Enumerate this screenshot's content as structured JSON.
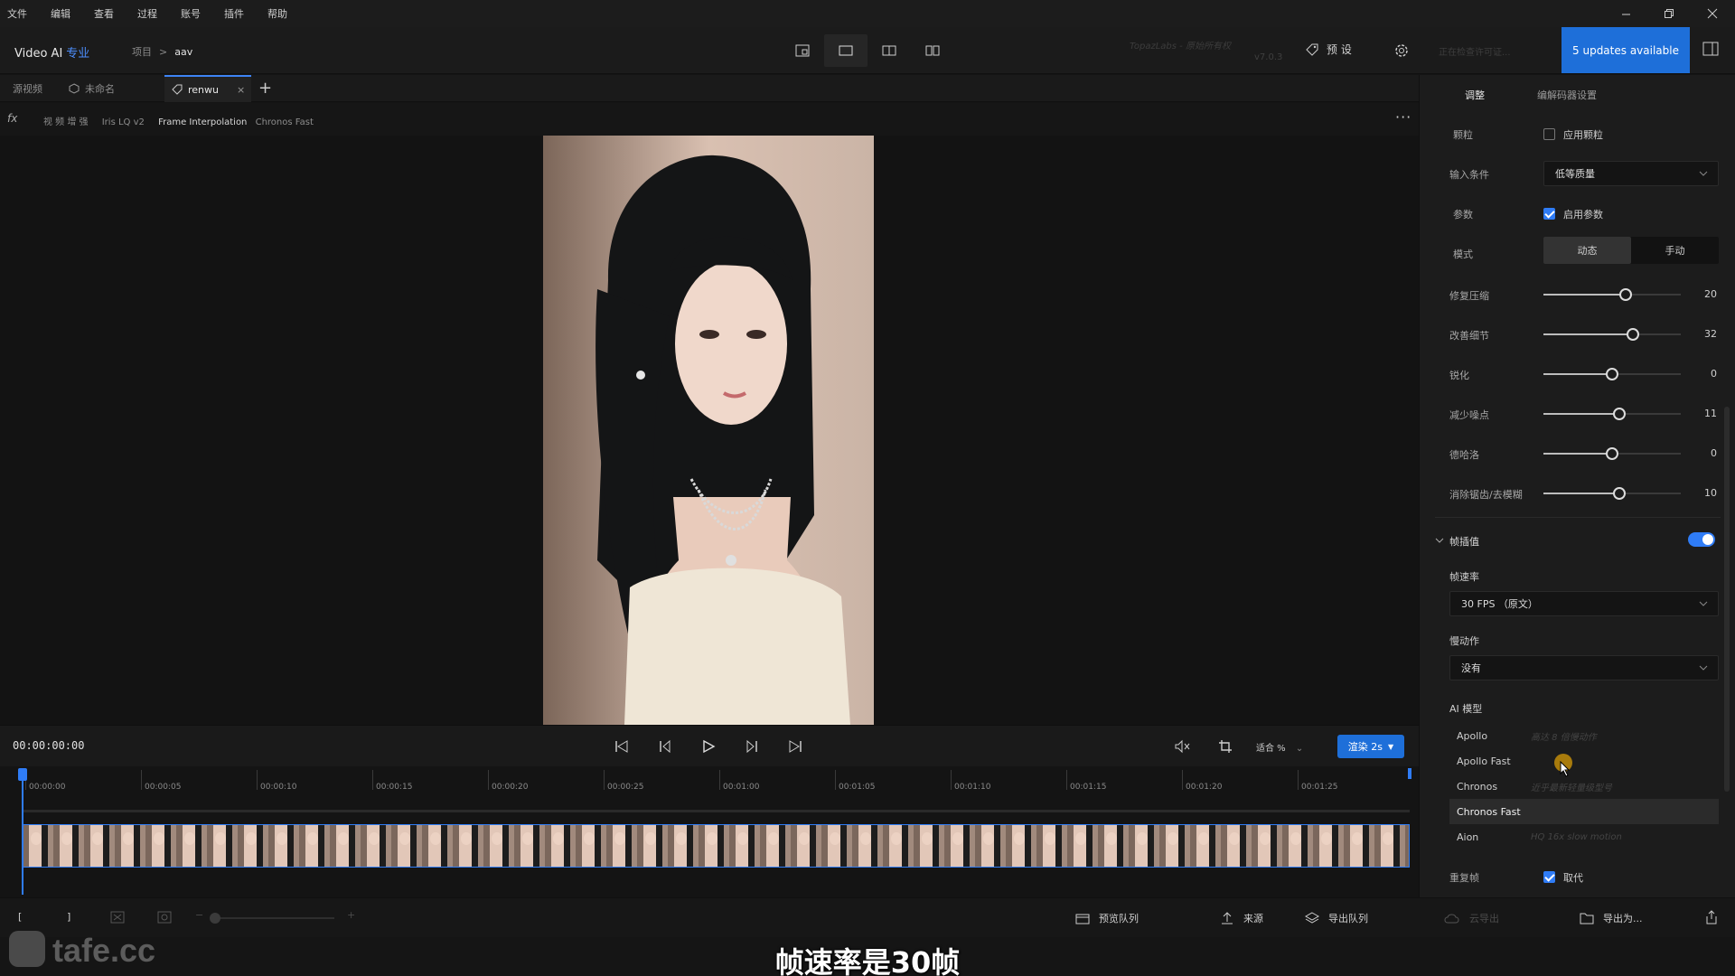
{
  "menubar": {
    "items": [
      "文件",
      "编辑",
      "查看",
      "过程",
      "账号",
      "插件",
      "帮助"
    ],
    "window_controls": [
      "minimize-icon",
      "restore-icon",
      "close-icon"
    ]
  },
  "header": {
    "app_name": "Video AI",
    "edition": "专业",
    "breadcrumb_root": "项目",
    "breadcrumb_current": "aav",
    "brand_text": "TopazLabs - 原始所有权",
    "version": "v7.0.3",
    "preset_label": "预 设",
    "checking_text": "正在检查许可证...",
    "updates_label": "5 updates available"
  },
  "tabs": {
    "source": "源视频",
    "untitled": "未命名",
    "active": "renwu"
  },
  "fxbar": {
    "fx": "fx",
    "enhance": "视 频 增 强",
    "model": "Iris LQ v2",
    "interp": "Frame Interpolation",
    "interp_model": "Chronos Fast"
  },
  "transport": {
    "timecode": "00:00:00:00",
    "fit_label": "适合  %",
    "render_label": "渲染 2s"
  },
  "timeline": {
    "ticks": [
      "00:00:00",
      "00:00:05",
      "00:00:10",
      "00:00:15",
      "00:00:20",
      "00:00:25",
      "00:01:00",
      "00:01:05",
      "00:01:10",
      "00:01:15",
      "00:01:20",
      "00:01:25"
    ]
  },
  "footer": {
    "preview_queue": "预览队列",
    "source": "来源",
    "export_queue": "导出队列",
    "cloud_export": "云导出",
    "export_as": "导出为..."
  },
  "sidebar": {
    "tab_adjust": "调整",
    "tab_encoder": "编解码器设置",
    "grain_label": "颗粒",
    "grain_check": "应用颗粒",
    "input_label": "输入条件",
    "input_value": "低等质量",
    "params_label": "参数",
    "params_check": "启用参数",
    "mode_label": "模式",
    "mode_auto": "动态",
    "mode_manual": "手动",
    "sliders": [
      {
        "label": "修复压缩",
        "value": 20
      },
      {
        "label": "改善细节",
        "value": 32
      },
      {
        "label": "锐化",
        "value": 0
      },
      {
        "label": "减少噪点",
        "value": 11
      },
      {
        "label": "德哈洛",
        "value": 0
      },
      {
        "label": "消除锯齿/去模糊",
        "value": 10
      }
    ],
    "interp_section": "帧插值",
    "fps_label": "帧速率",
    "fps_value": "30 FPS （原文）",
    "slowmo_label": "慢动作",
    "slowmo_value": "没有",
    "ai_model_label": "AI 模型",
    "models": [
      {
        "name": "Apollo",
        "desc": "高达 8 倍慢动作"
      },
      {
        "name": "Apollo Fast",
        "desc": ""
      },
      {
        "name": "Chronos",
        "desc": "近乎最新轻量级型号"
      },
      {
        "name": "Chronos Fast",
        "desc": ""
      },
      {
        "name": "Aion",
        "desc": "HQ 16x slow motion"
      }
    ],
    "dup_label": "重复帧",
    "dup_check": "取代"
  },
  "overlay": {
    "watermark": "tafe.cc",
    "subtitle": "帧速率是30帧"
  },
  "colors": {
    "accent": "#1e6fd9",
    "bg": "#151515"
  }
}
